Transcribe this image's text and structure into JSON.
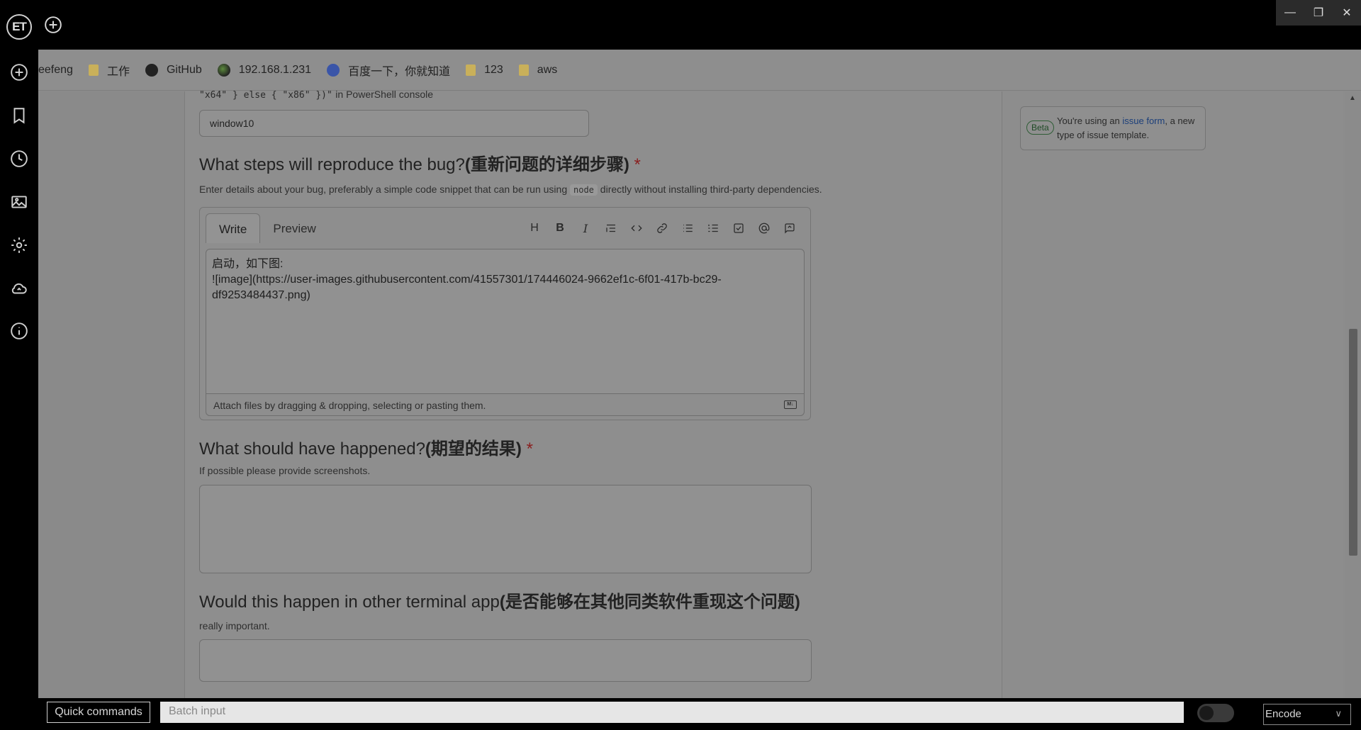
{
  "app": {
    "logo": "ET"
  },
  "bookmarks": [
    {
      "label": "eefeng",
      "icon": "none"
    },
    {
      "label": "工作",
      "icon": "folder-icon"
    },
    {
      "label": "GitHub",
      "icon": "github-icon"
    },
    {
      "label": "192.168.1.231",
      "icon": "network-icon"
    },
    {
      "label": "百度一下，你就知道",
      "icon": "baidu-icon"
    },
    {
      "label": "123",
      "icon": "folder-icon"
    },
    {
      "label": "aws",
      "icon": "folder-icon"
    }
  ],
  "form": {
    "os_hint_code": "\"x64\" } else { \"x86\" })\"",
    "os_hint_text": "in PowerShell console",
    "os_value": "window10",
    "steps": {
      "title": "What steps will reproduce the bug?",
      "title_cn": "(重新问题的详细步骤)",
      "required_mark": "*",
      "desc_before": "Enter details about your bug, preferably a simple code snippet that can be run using",
      "desc_code": "node",
      "desc_after": "directly without installing third-party dependencies.",
      "tab_write": "Write",
      "tab_preview": "Preview",
      "content_line1": "启动，如下图:",
      "content_line2": "![image](https://user-images.githubusercontent.com/41557301/174446024-9662ef1c-6f01-417b-bc29-df9253484437.png)",
      "attach_text": "Attach files by dragging & dropping, selecting or pasting them."
    },
    "expected": {
      "title": "What should have happened?",
      "title_cn": "(期望的结果)",
      "required_mark": "*",
      "desc": "If possible please provide screenshots."
    },
    "other": {
      "title": "Would this happen in other terminal app",
      "title_cn": "(是否能够在其他同类软件重现这个问题)",
      "desc": "really important."
    }
  },
  "sidebar_note": {
    "badge": "Beta",
    "text_before": "You're using an",
    "link": "issue form",
    "text_after": ", a new type of issue template."
  },
  "bottom": {
    "quick_commands": "Quick commands",
    "batch_placeholder": "Batch input",
    "encode": "Encode"
  }
}
